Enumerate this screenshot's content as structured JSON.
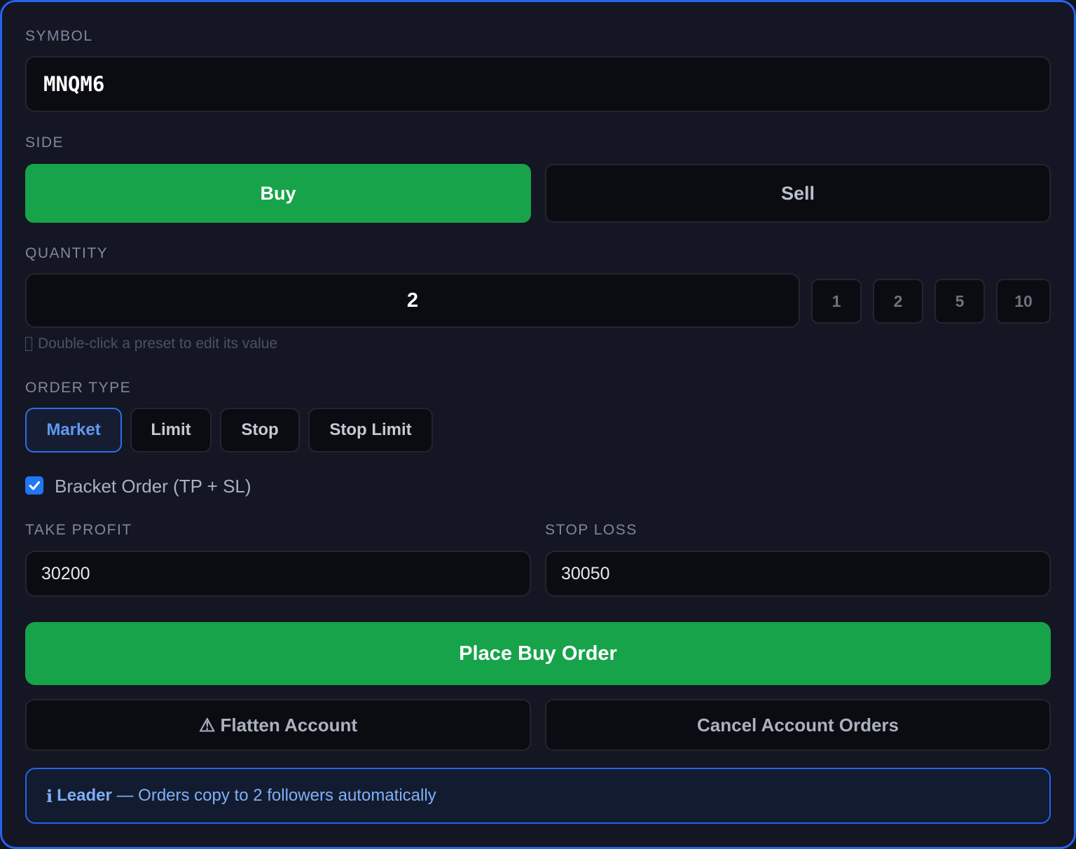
{
  "symbol": {
    "label": "SYMBOL",
    "value": "MNQM6"
  },
  "side": {
    "label": "SIDE",
    "buy_label": "Buy",
    "sell_label": "Sell",
    "selected": "Buy"
  },
  "quantity": {
    "label": "QUANTITY",
    "value": "2",
    "presets": [
      "1",
      "2",
      "5",
      "10"
    ],
    "hint_icon": "info-icon",
    "hint": "Double-click a preset to edit its value"
  },
  "order_type": {
    "label": "ORDER TYPE",
    "options": [
      "Market",
      "Limit",
      "Stop",
      "Stop Limit"
    ],
    "selected": "Market"
  },
  "bracket": {
    "checked": true,
    "label": "Bracket Order (TP + SL)"
  },
  "take_profit": {
    "label": "TAKE PROFIT",
    "value": "30200"
  },
  "stop_loss": {
    "label": "STOP LOSS",
    "value": "30050"
  },
  "actions": {
    "place_order_label": "Place Buy Order",
    "flatten_icon": "warning-icon",
    "flatten_label": "⚠ Flatten Account",
    "cancel_label": "Cancel Account Orders"
  },
  "info": {
    "icon": "info-icon",
    "icon_glyph": "i",
    "role": "Leader",
    "message": " — Orders copy to 2 followers automatically"
  },
  "colors": {
    "accent": "#2563eb",
    "buy": "#16a34a",
    "background": "#141624",
    "field": "#0b0c12"
  }
}
